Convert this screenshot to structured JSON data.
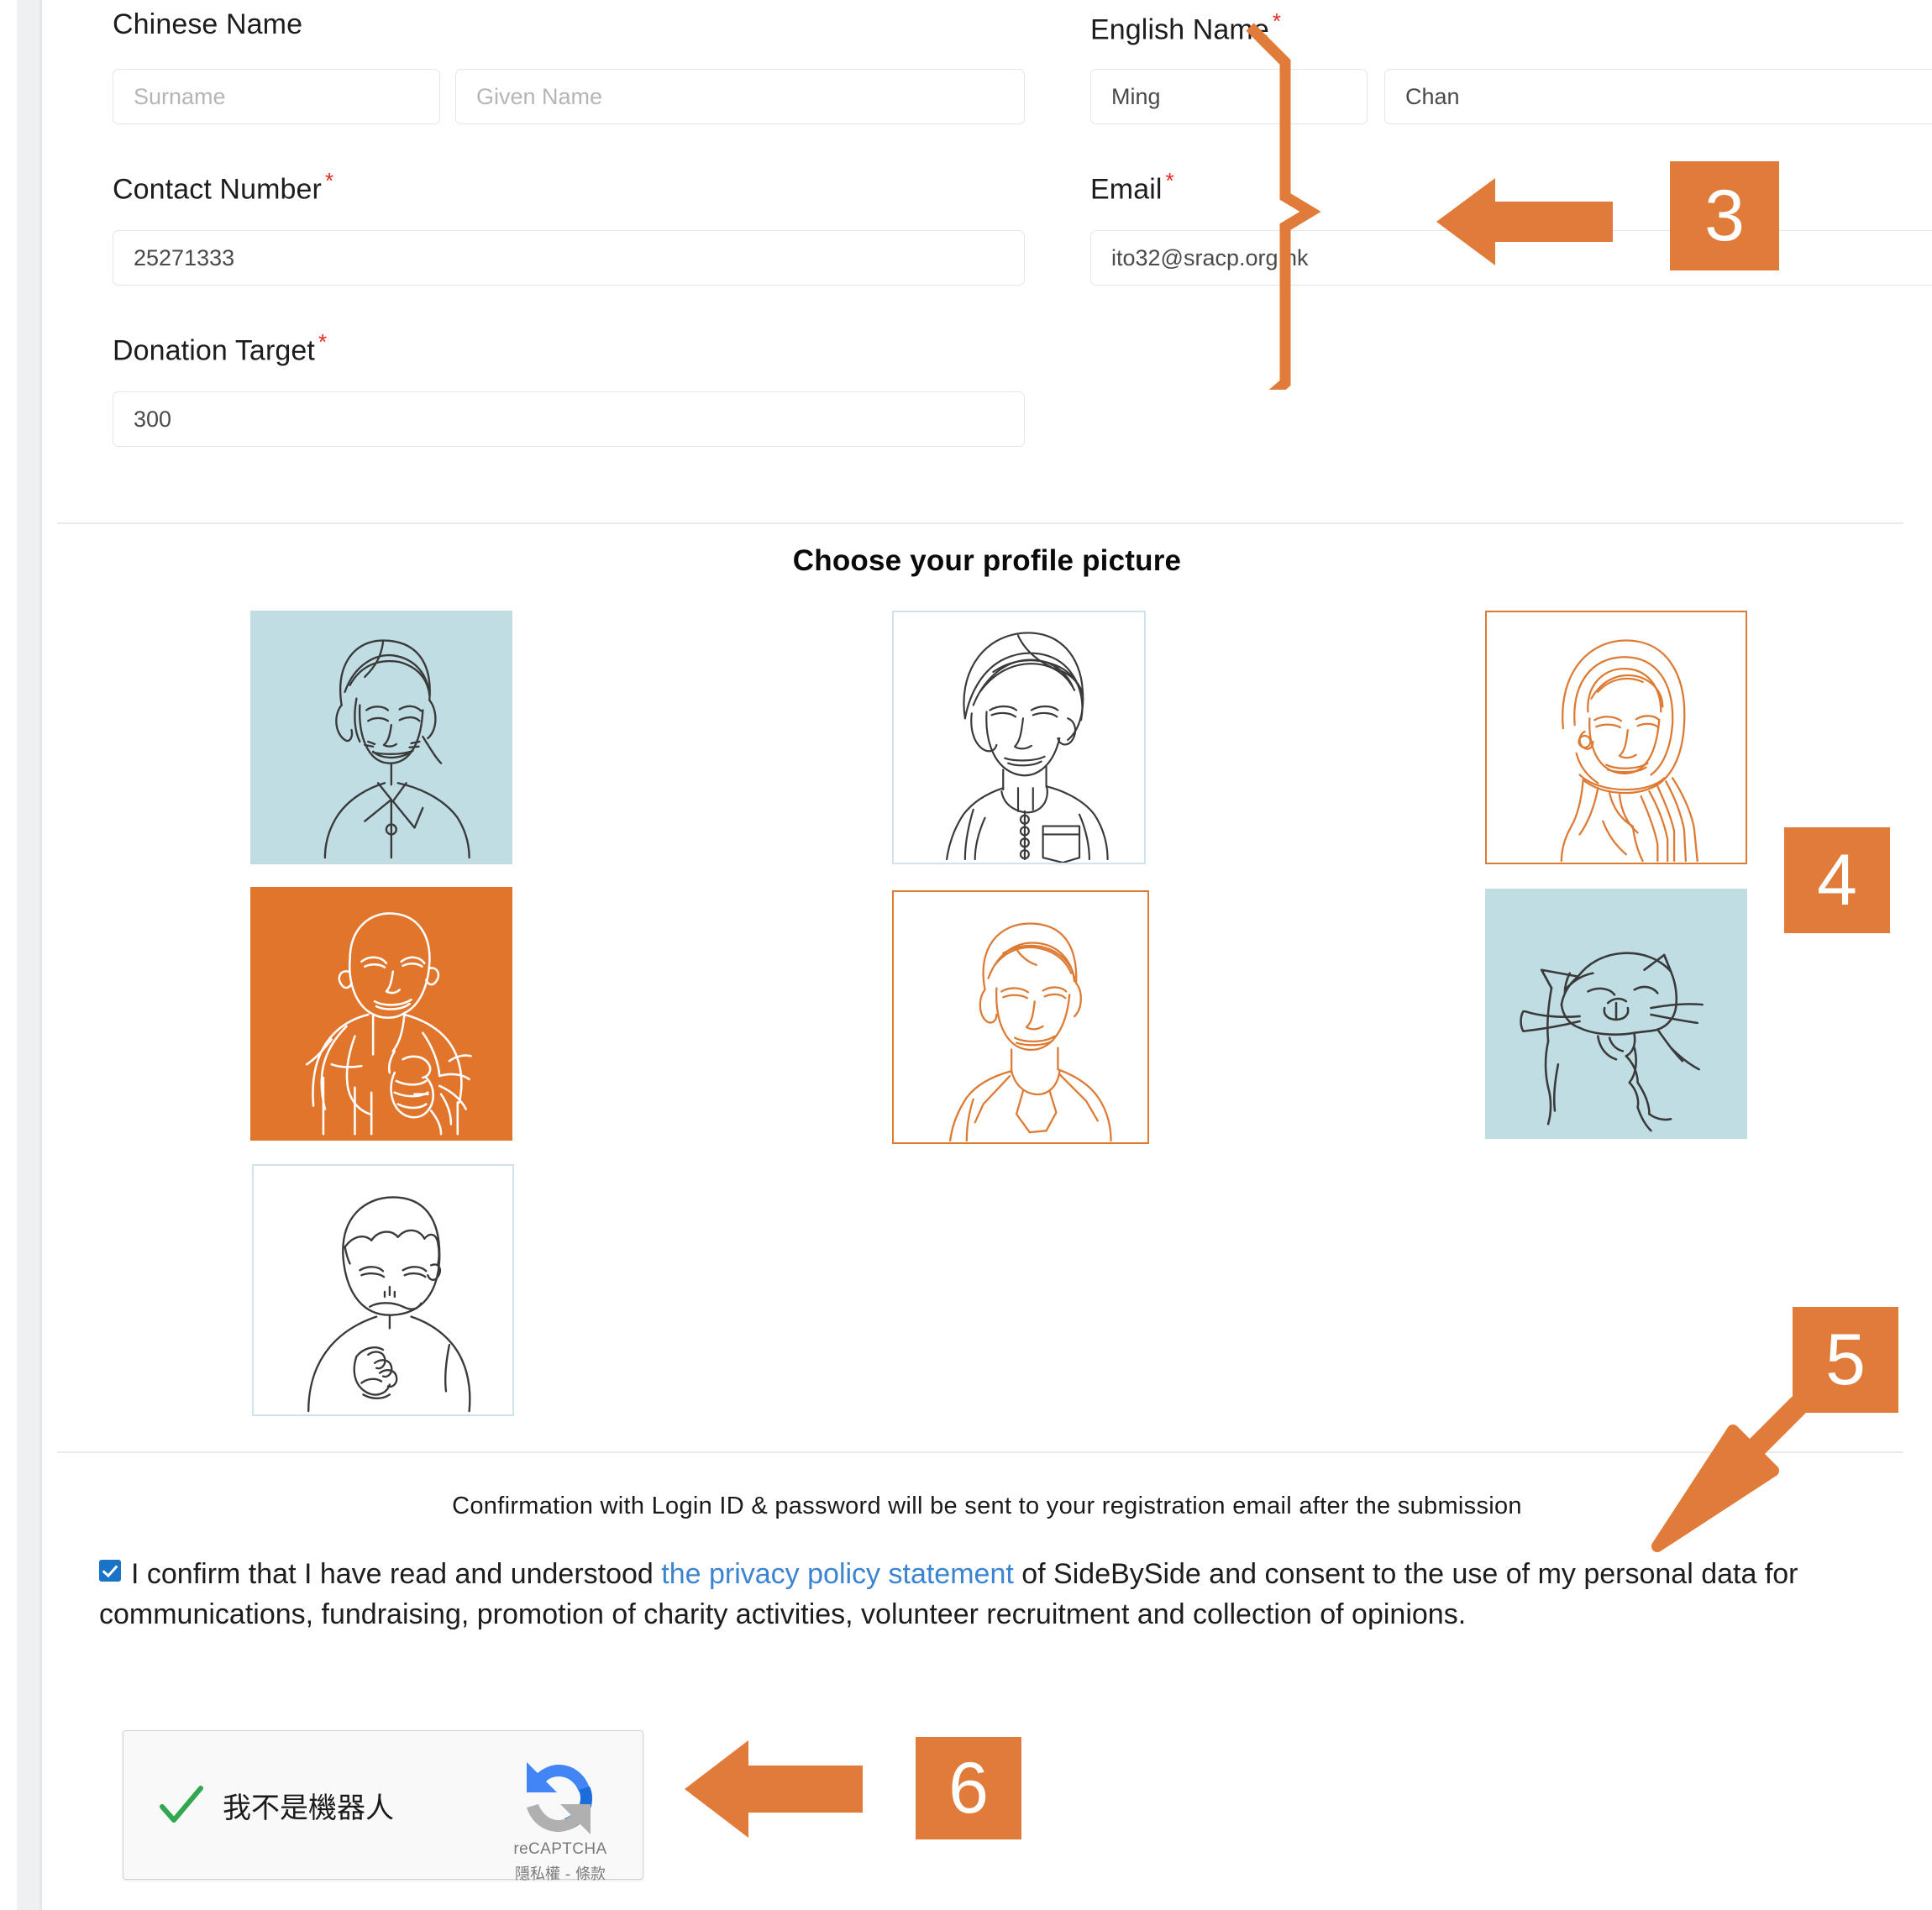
{
  "form": {
    "chinese_name": {
      "label": "Chinese Name",
      "surname_placeholder": "Surname",
      "given_placeholder": "Given Name",
      "surname_value": "",
      "given_value": ""
    },
    "english_name": {
      "label": "English Name",
      "required_mark": "*",
      "first_value": "Ming",
      "last_value": "Chan"
    },
    "contact_number": {
      "label": "Contact Number",
      "required_mark": "*",
      "value": "25271333"
    },
    "email": {
      "label": "Email",
      "required_mark": "*",
      "value": "ito32@sracp.org.hk"
    },
    "donation_target": {
      "label": "Donation Target",
      "required_mark": "*",
      "value": "300"
    }
  },
  "profile_picker": {
    "title": "Choose your profile picture",
    "options": [
      {
        "id": "woman-smiling",
        "name": "avatar-woman-smiling",
        "background": "#bfdde3",
        "line_color": "#3a3a3a",
        "border": "#bfdde3"
      },
      {
        "id": "elderly-person",
        "name": "avatar-elderly-person",
        "background": "#e2752c",
        "line_color": "#ffffff",
        "border": "#e2752c"
      },
      {
        "id": "child-boy",
        "name": "avatar-child-boy",
        "background": "#ffffff",
        "line_color": "#3a3a3a",
        "border": "#cfe3ea"
      },
      {
        "id": "man-turban",
        "name": "avatar-man-turban",
        "background": "#ffffff",
        "line_color": "#3a3a3a",
        "border": "#cfe3ea"
      },
      {
        "id": "young-man",
        "name": "avatar-young-man",
        "background": "#ffffff",
        "line_color": "#dd7a33",
        "border": "#dd7a33"
      },
      {
        "id": "woman-hijab",
        "name": "avatar-woman-hijab",
        "background": "#ffffff",
        "line_color": "#dd7a33",
        "border": "#dd7a33"
      },
      {
        "id": "cat",
        "name": "avatar-cat",
        "background": "#bfdde3",
        "line_color": "#3a3a3a",
        "border": "#bfdde3"
      }
    ]
  },
  "footer": {
    "note": "Confirmation with Login ID & password will be sent to your registration email after the submission",
    "consent": {
      "checked": true,
      "text_before": "I confirm that I have read and understood ",
      "link_text": "the privacy policy statement",
      "text_after": " of SideBySide and consent to the use of my personal data for communications, fundraising, promotion of charity activities, volunteer recruitment and collection of opinions."
    },
    "recaptcha": {
      "label": "我不是機器人",
      "brand": "reCAPTCHA",
      "terms": "隱私權 - 條款",
      "checked": true
    }
  },
  "annotations": {
    "accent_color": "#e07b39",
    "markers": [
      {
        "number": "3",
        "target": "english-name-and-email-fields"
      },
      {
        "number": "4",
        "target": "profile-picture-grid"
      },
      {
        "number": "5",
        "target": "privacy-consent-checkbox"
      },
      {
        "number": "6",
        "target": "recaptcha-widget"
      }
    ]
  }
}
